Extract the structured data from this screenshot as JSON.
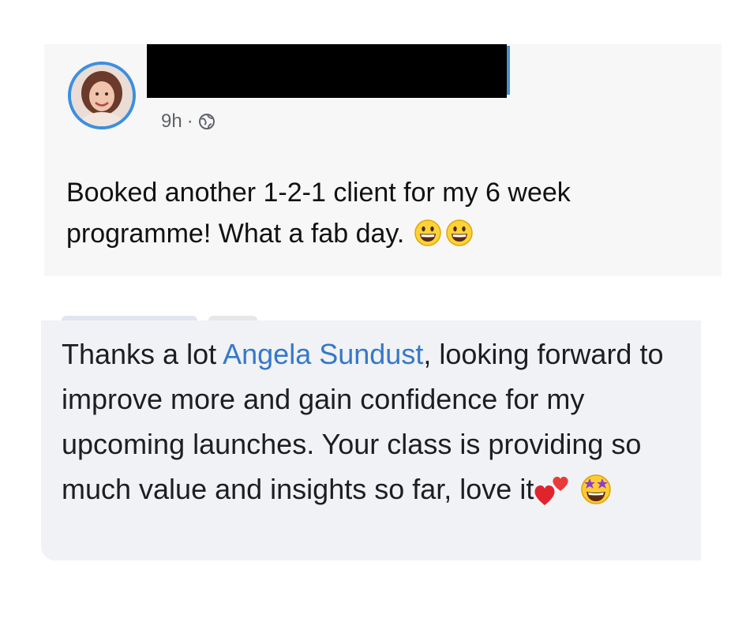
{
  "post": {
    "author_redacted": true,
    "timestamp": "9h",
    "separator": "·",
    "privacy_icon": "globe-icon",
    "text": "Booked another 1-2-1 client for my 6 week programme! What a fab day.",
    "emojis": [
      "grinning-face",
      "grinning-face"
    ]
  },
  "comment": {
    "text_before": "Thanks a lot ",
    "mention": "Angela Sundust",
    "text_after": ", looking forward to improve more and gain confidence for my upcoming launches. Your class is providing so much value and insights so far, love it",
    "emojis": [
      "two-hearts",
      "star-struck"
    ]
  },
  "colors": {
    "mention": "#3578c9",
    "avatar_ring": "#3b8fe0",
    "post_bg": "#f7f7f7",
    "comment_bg": "#f0f2f5"
  }
}
